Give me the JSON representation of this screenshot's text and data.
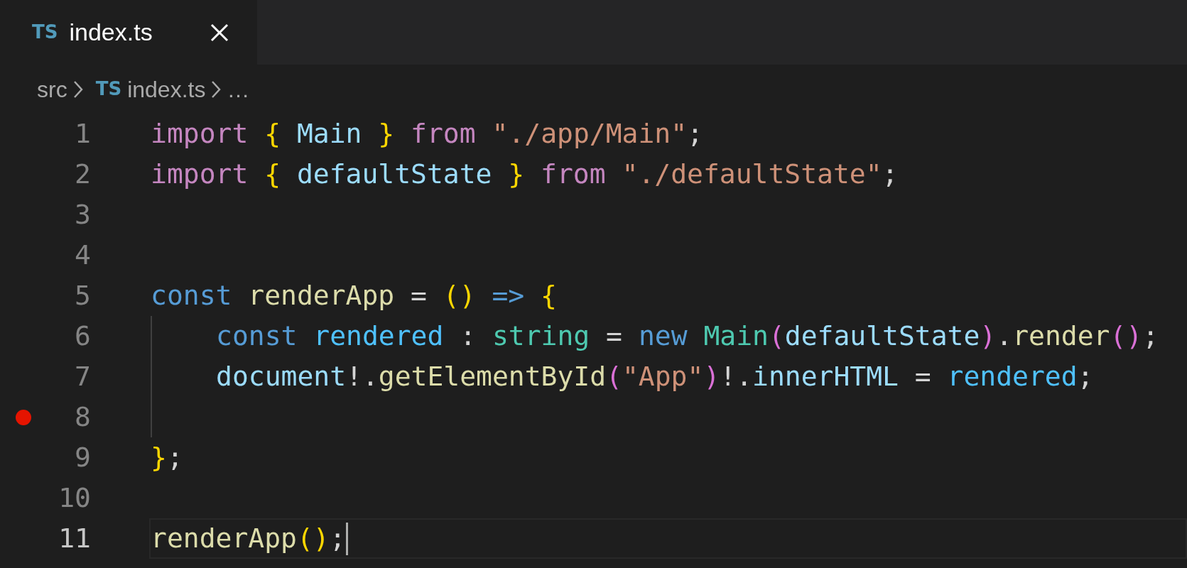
{
  "tabs": [
    {
      "icon_text": "TS",
      "label": "index.ts",
      "selected": true
    }
  ],
  "breadcrumb": [
    {
      "label": "src"
    },
    {
      "icon_text": "TS",
      "label": "index.ts"
    },
    {
      "label": "…"
    }
  ],
  "lines": [
    {
      "number": "1",
      "breakpoint": false,
      "current": false,
      "indented": false,
      "tokens": [
        {
          "kind": "keyword",
          "text": "import "
        },
        {
          "kind": "bracket1",
          "text": "{"
        },
        {
          "kind": "variable",
          "text": " Main "
        },
        {
          "kind": "bracket1",
          "text": "}"
        },
        {
          "kind": "keyword",
          "text": " from "
        },
        {
          "kind": "string",
          "text": "\"./app/Main\""
        },
        {
          "kind": "plain",
          "text": ";"
        }
      ]
    },
    {
      "number": "2",
      "breakpoint": false,
      "current": false,
      "indented": false,
      "tokens": [
        {
          "kind": "keyword",
          "text": "import "
        },
        {
          "kind": "bracket1",
          "text": "{"
        },
        {
          "kind": "variable",
          "text": " defaultState "
        },
        {
          "kind": "bracket1",
          "text": "}"
        },
        {
          "kind": "keyword",
          "text": " from "
        },
        {
          "kind": "string",
          "text": "\"./defaultState\""
        },
        {
          "kind": "plain",
          "text": ";"
        }
      ]
    },
    {
      "number": "3",
      "breakpoint": false,
      "current": false,
      "indented": false
    },
    {
      "number": "4",
      "breakpoint": false,
      "current": false,
      "indented": false
    },
    {
      "number": "5",
      "breakpoint": false,
      "current": false,
      "indented": false,
      "tokens": [
        {
          "kind": "storage",
          "text": "const "
        },
        {
          "kind": "function",
          "text": "renderApp"
        },
        {
          "kind": "plain",
          "text": " = "
        },
        {
          "kind": "bracket1",
          "text": "()"
        },
        {
          "kind": "storage",
          "text": " => "
        },
        {
          "kind": "bracket1",
          "text": "{"
        }
      ]
    },
    {
      "number": "6",
      "breakpoint": false,
      "current": false,
      "indented": true,
      "tokens": [
        {
          "kind": "storage",
          "text": "const "
        },
        {
          "kind": "constant",
          "text": "rendered"
        },
        {
          "kind": "plain",
          "text": " : "
        },
        {
          "kind": "type",
          "text": "string"
        },
        {
          "kind": "plain",
          "text": " = "
        },
        {
          "kind": "storage",
          "text": "new "
        },
        {
          "kind": "type",
          "text": "Main"
        },
        {
          "kind": "bracket2",
          "text": "("
        },
        {
          "kind": "variable",
          "text": "defaultState"
        },
        {
          "kind": "bracket2",
          "text": ")"
        },
        {
          "kind": "plain",
          "text": "."
        },
        {
          "kind": "function",
          "text": "render"
        },
        {
          "kind": "bracket2",
          "text": "()"
        },
        {
          "kind": "plain",
          "text": ";"
        }
      ]
    },
    {
      "number": "7",
      "breakpoint": false,
      "current": false,
      "indented": true,
      "tokens": [
        {
          "kind": "variable",
          "text": "document"
        },
        {
          "kind": "plain",
          "text": "!."
        },
        {
          "kind": "function",
          "text": "getElementById"
        },
        {
          "kind": "bracket2",
          "text": "("
        },
        {
          "kind": "string",
          "text": "\"App\""
        },
        {
          "kind": "bracket2",
          "text": ")"
        },
        {
          "kind": "plain",
          "text": "!."
        },
        {
          "kind": "variable",
          "text": "innerHTML"
        },
        {
          "kind": "plain",
          "text": " = "
        },
        {
          "kind": "constant",
          "text": "rendered"
        },
        {
          "kind": "plain",
          "text": ";"
        }
      ]
    },
    {
      "number": "8",
      "breakpoint": true,
      "current": false,
      "indented": true
    },
    {
      "number": "9",
      "breakpoint": false,
      "current": false,
      "indented": false,
      "tokens": [
        {
          "kind": "bracket1",
          "text": "}"
        },
        {
          "kind": "plain",
          "text": ";"
        }
      ]
    },
    {
      "number": "10",
      "breakpoint": false,
      "current": false,
      "indented": false
    },
    {
      "number": "11",
      "breakpoint": false,
      "current": true,
      "indented": false,
      "tokens": [
        {
          "kind": "function",
          "text": "renderApp"
        },
        {
          "kind": "bracket1",
          "text": "()"
        },
        {
          "kind": "plain",
          "text": ";"
        }
      ]
    }
  ]
}
